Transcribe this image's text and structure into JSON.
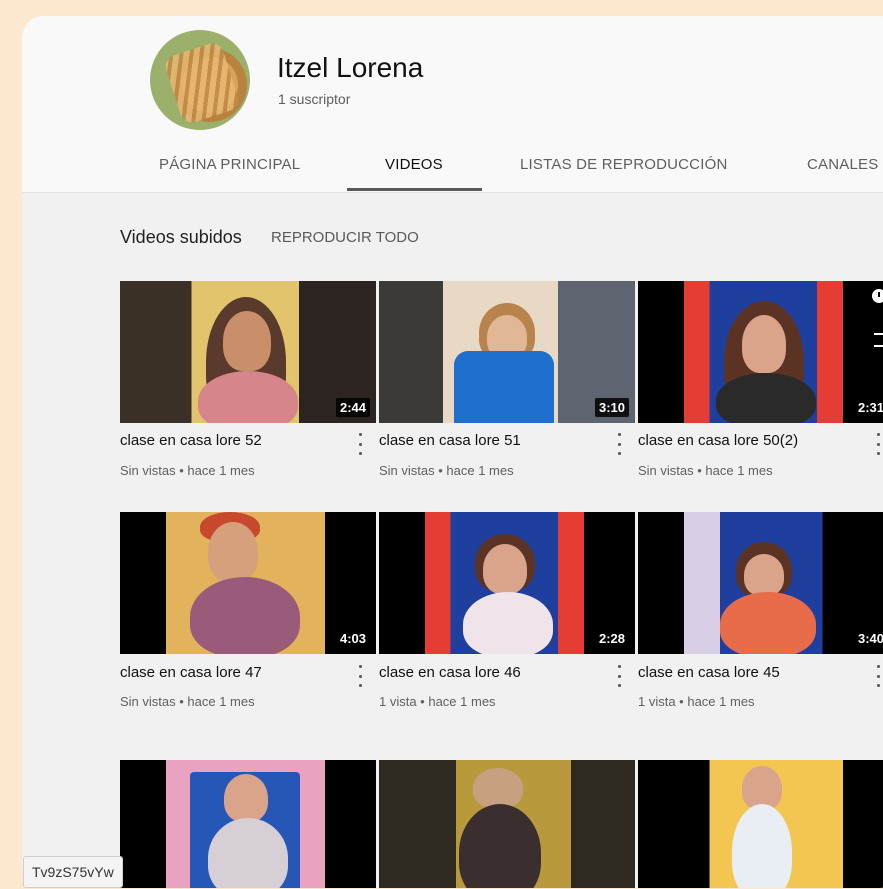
{
  "channel": {
    "name": "Itzel Lorena",
    "subscribers": "1 suscriptor"
  },
  "tabs": [
    {
      "label": "PÁGINA PRINCIPAL"
    },
    {
      "label": "VIDEOS"
    },
    {
      "label": "LISTAS DE REPRODUCCIÓN"
    },
    {
      "label": "CANALES"
    }
  ],
  "section": {
    "title": "Videos subidos",
    "play_all": "REPRODUCIR TODO"
  },
  "videos": [
    {
      "title": "clase en casa lore 52",
      "meta": "Sin vistas • hace 1 mes",
      "duration": "2:44"
    },
    {
      "title": "clase en casa lore 51",
      "meta": "Sin vistas • hace 1 mes",
      "duration": "3:10"
    },
    {
      "title": "clase en casa lore 50(2)",
      "meta": "Sin vistas • hace 1 mes",
      "duration": "2:31"
    },
    {
      "title": "clase en casa lore 47",
      "meta": "Sin vistas • hace 1 mes",
      "duration": "4:03"
    },
    {
      "title": "clase en casa lore 46",
      "meta": "1 vista • hace 1 mes",
      "duration": "2:28"
    },
    {
      "title": "clase en casa lore 45",
      "meta": "1 vista • hace 1 mes",
      "duration": "3:40"
    }
  ],
  "url_tooltip": "Tv9zS75vYw"
}
